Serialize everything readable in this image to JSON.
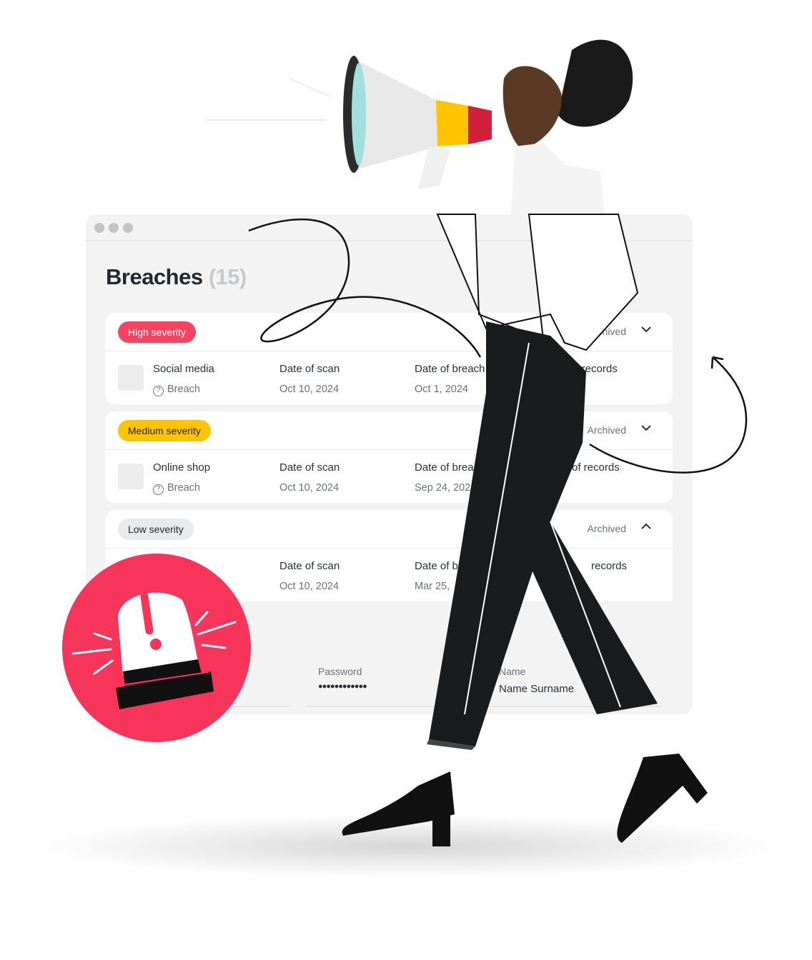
{
  "window": {
    "title": "Breaches",
    "count": "(15)"
  },
  "cards": [
    {
      "severity": "High severity",
      "severity_color": "#f7435f",
      "severity_text_color": "#ffffff",
      "status": "Archived",
      "expanded": false,
      "name": "Social media",
      "type": "Breach",
      "scan_label": "Date of scan",
      "scan_date": "Oct 10, 2024",
      "breach_label": "Date of breach",
      "breach_date": "Oct 1, 2024",
      "records_label": "of records"
    },
    {
      "severity": "Medium severity",
      "severity_color": "#ffc400",
      "severity_text_color": "#23282d",
      "status": "Archived",
      "expanded": false,
      "name": "Online shop",
      "type": "Breach",
      "scan_label": "Date of scan",
      "scan_date": "Oct 10, 2024",
      "breach_label": "Date of breach",
      "breach_date": "Sep 24, 2024",
      "records_label": "of records"
    },
    {
      "severity": "Low severity",
      "severity_color": "#e9eaeb",
      "severity_text_color": "#23282d",
      "status": "Archived",
      "expanded": true,
      "scan_label": "Date of scan",
      "scan_date": "Oct 10, 2024",
      "breach_label": "Date of breach",
      "breach_date": "Mar 25,",
      "records_label": "records"
    }
  ],
  "details": {
    "password_label": "Password",
    "password_value": "●●●●●●●●●●●●",
    "name_label": "Name",
    "name_value": "Name Surname"
  },
  "colors": {
    "alert": "#f7355a",
    "accent_yellow": "#ffc400"
  },
  "icons": [
    "question-circle-icon",
    "chevron-down-icon",
    "chevron-up-icon",
    "alert-siren-icon",
    "megaphone-icon"
  ]
}
